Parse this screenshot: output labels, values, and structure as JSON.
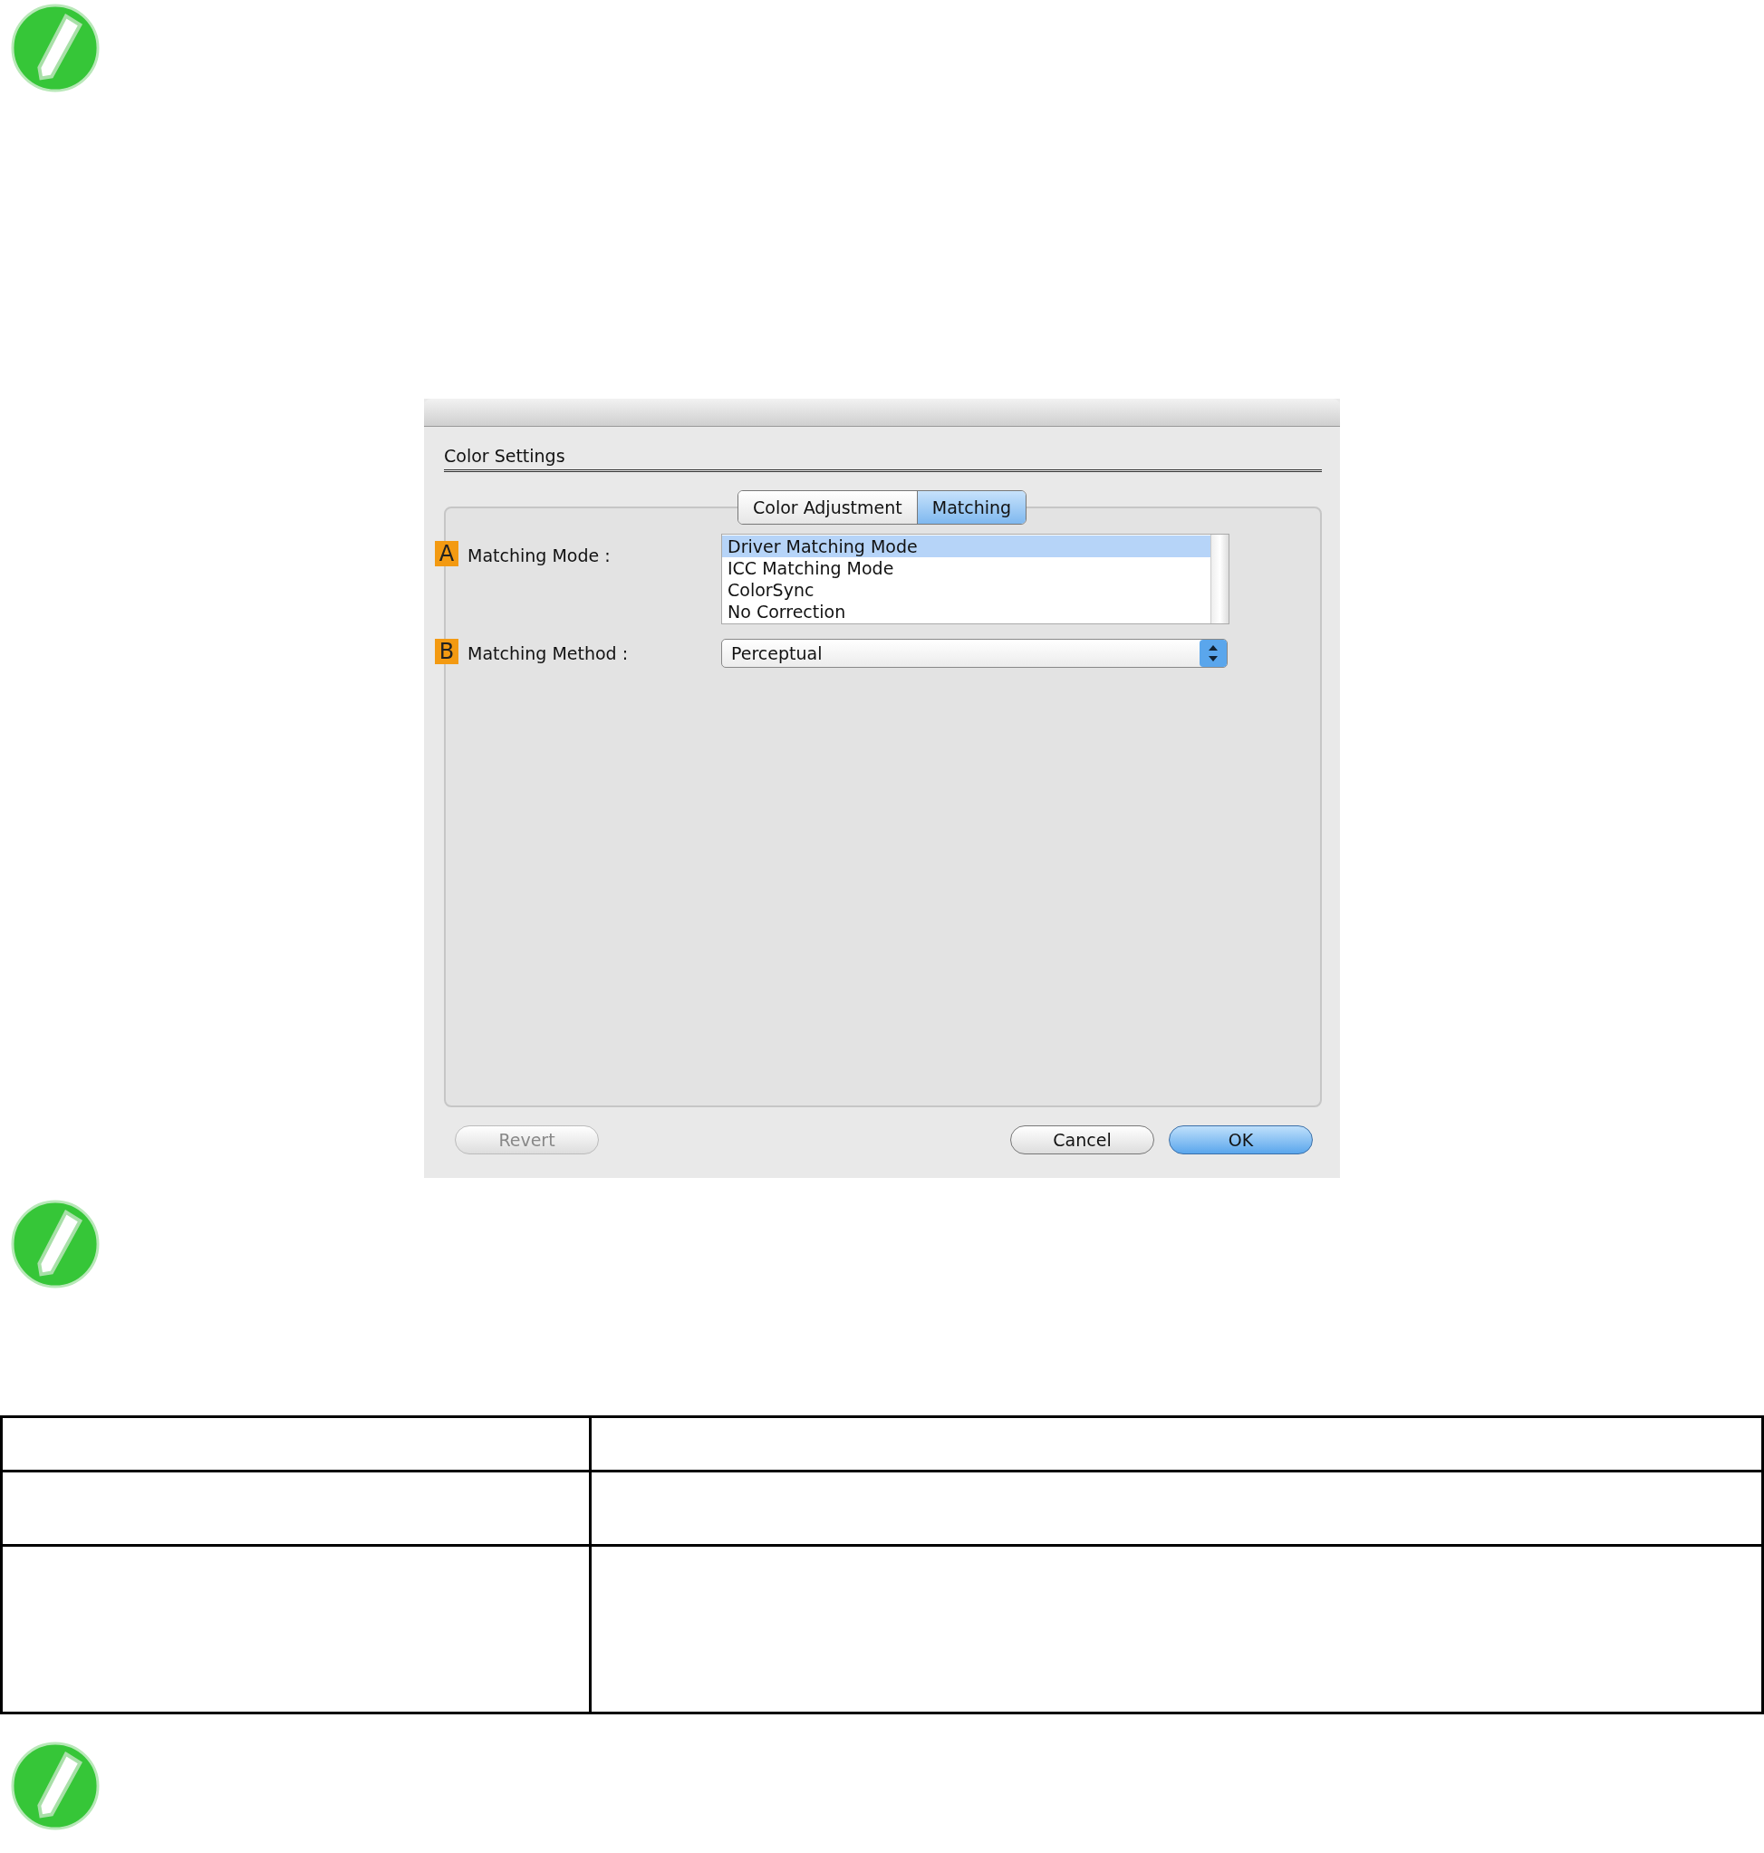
{
  "dialog": {
    "section_title": "Color Settings",
    "tabs": [
      {
        "label": "Color Adjustment",
        "selected": false
      },
      {
        "label": "Matching",
        "selected": true
      }
    ],
    "fields": [
      {
        "kind": "list",
        "marker": "A",
        "label": "Matching Mode :",
        "options": [
          {
            "label": "Driver Matching Mode",
            "selected": true
          },
          {
            "label": "ICC Matching Mode",
            "selected": false
          },
          {
            "label": "ColorSync",
            "selected": false
          },
          {
            "label": "No Correction",
            "selected": false
          }
        ]
      },
      {
        "kind": "popup",
        "marker": "B",
        "label": "Matching Method :",
        "value": "Perceptual"
      }
    ],
    "left_buttons": [
      {
        "label": "Revert",
        "disabled": true,
        "default": false
      }
    ],
    "right_buttons": [
      {
        "label": "Cancel",
        "disabled": false,
        "default": false
      },
      {
        "label": "OK",
        "disabled": false,
        "default": true
      }
    ]
  }
}
